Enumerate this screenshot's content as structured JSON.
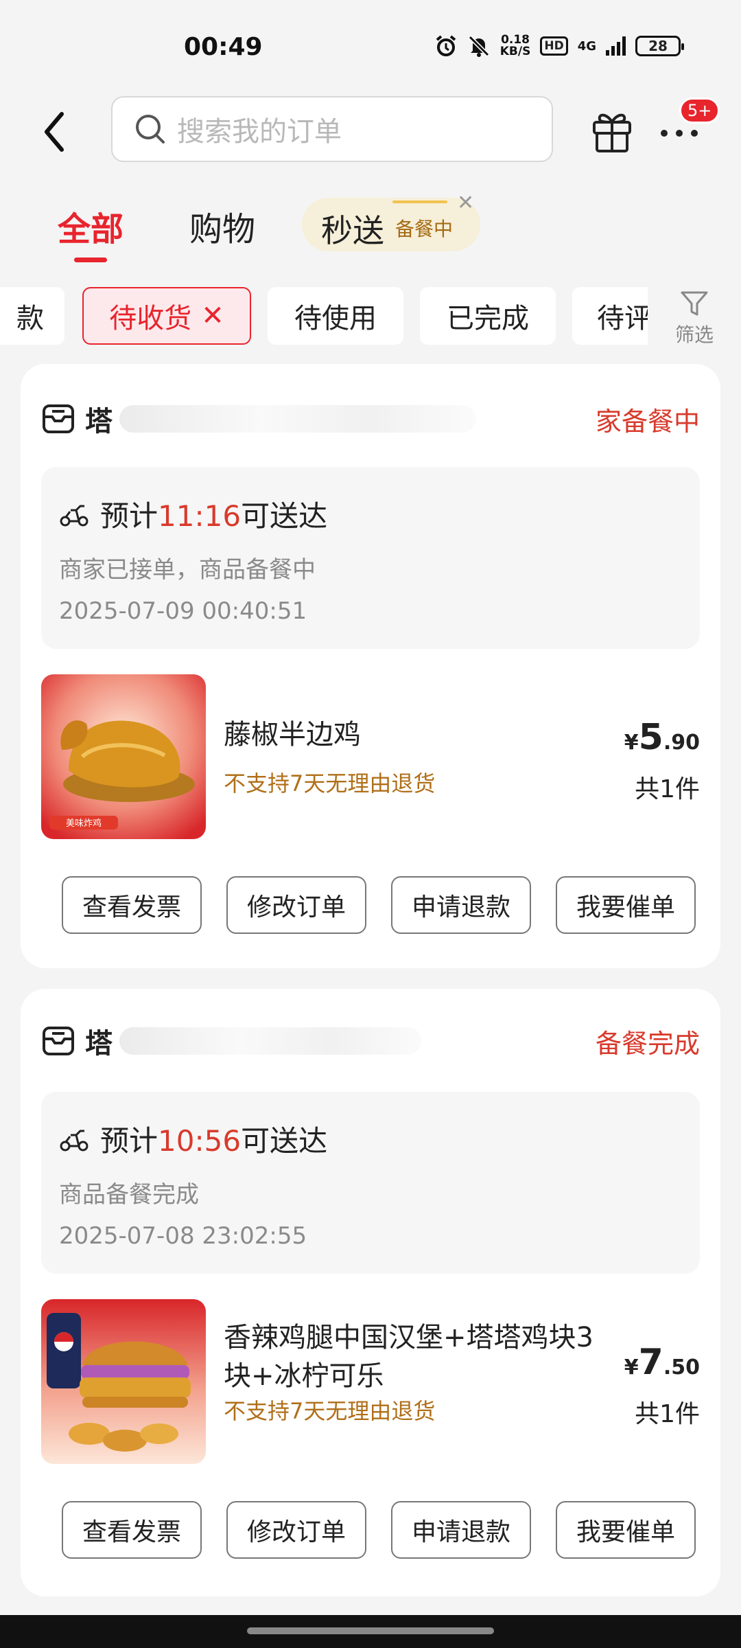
{
  "status_bar": {
    "time": "00:49",
    "net_speed_value": "0.18",
    "net_speed_unit": "KB/S",
    "hd": "HD",
    "network": "4G",
    "battery": "28"
  },
  "header": {
    "search_placeholder": "搜索我的订单",
    "badge": "5+"
  },
  "category_tabs": {
    "all": "全部",
    "shopping": "购物",
    "fast_delivery": "秒送",
    "fast_delivery_sub": "备餐中"
  },
  "filters": {
    "chips": [
      "款",
      "待收货",
      "待使用",
      "已完成",
      "待评"
    ],
    "active_index": 1,
    "filter_label": "筛选"
  },
  "orders": [
    {
      "store_prefix": "塔",
      "status": "家备餐中",
      "eta_prefix": "预计",
      "eta_time": "11:16",
      "eta_suffix": "可送达",
      "delivery_status": "商家已接单，商品备餐中",
      "order_time": "2025-07-09 00:40:51",
      "product_name": "藤椒半边鸡",
      "product_note": "不支持7天无理由退货",
      "image_label": "美味炸鸡",
      "price_currency": "¥",
      "price_int": "5",
      "price_dec": ".90",
      "qty": "共1件",
      "actions": [
        "查看发票",
        "修改订单",
        "申请退款",
        "我要催单"
      ]
    },
    {
      "store_prefix": "塔",
      "status": "备餐完成",
      "eta_prefix": "预计",
      "eta_time": "10:56",
      "eta_suffix": "可送达",
      "delivery_status": "商品备餐完成",
      "order_time": "2025-07-08 23:02:55",
      "product_name": "香辣鸡腿中国汉堡+塔塔鸡块3块+冰柠可乐",
      "product_note": "不支持7天无理由退货",
      "price_currency": "¥",
      "price_int": "7",
      "price_dec": ".50",
      "qty": "共1件",
      "actions": [
        "查看发票",
        "修改订单",
        "申请退款",
        "我要催单"
      ]
    }
  ],
  "colors": {
    "accent_red": "#e8242d",
    "eta_red": "#d83a2c",
    "note_brown": "#b06f19"
  }
}
